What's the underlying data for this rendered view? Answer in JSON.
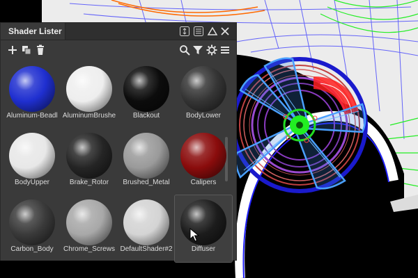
{
  "panel": {
    "title": "Shader Lister",
    "titlebar_icons": [
      "dock-toggle-icon",
      "menu-lines-icon",
      "collapse-triangle-icon",
      "close-icon"
    ],
    "toolbar_icons": [
      "add-icon",
      "duplicate-icon",
      "delete-icon",
      "search-icon",
      "filter-icon",
      "settings-icon",
      "menu-icon"
    ]
  },
  "shaders": [
    {
      "name": "Aluminum-Beadblasted",
      "display": "Aluminum-Beadl",
      "color": "#1f2fd0"
    },
    {
      "name": "AluminumBrushed",
      "display": "AluminumBrushe",
      "color": "#eeeeee"
    },
    {
      "name": "Blackout",
      "display": "Blackout",
      "color": "#0c0c0c"
    },
    {
      "name": "BodyLower",
      "display": "BodyLower",
      "color": "#353535"
    },
    {
      "name": "BodyUpper",
      "display": "BodyUpper",
      "color": "#e8e8e8"
    },
    {
      "name": "Brake_Rotor",
      "display": "Brake_Rotor",
      "color": "#252525"
    },
    {
      "name": "Brushed_Metal",
      "display": "Brushed_Metal",
      "color": "#9a9a9a"
    },
    {
      "name": "Calipers",
      "display": "Calipers",
      "color": "#8a0c0c"
    },
    {
      "name": "Carbon_Body",
      "display": "Carbon_Body",
      "color": "#3a3a3a"
    },
    {
      "name": "Chrome_Screws",
      "display": "Chrome_Screws",
      "color": "#a8a8a8"
    },
    {
      "name": "DefaultShader#2",
      "display": "DefaultShader#2",
      "color": "#d4d4d4"
    },
    {
      "name": "Diffuser",
      "display": "Diffuser",
      "color": "#1c1c1c"
    }
  ],
  "selected_index": 11,
  "colors": {
    "panel_bg": "#3a3a3a",
    "titlebar_bg": "#2f2f2f",
    "text": "#dcdcdc",
    "wireframe_blue": "#4aa0ff",
    "wireframe_green": "#22ff22",
    "hub_green": "#22dd22",
    "rotor_purple": "#9a4ad0",
    "caliper_red": "#ff2020",
    "tire_blue": "#1a1acc"
  }
}
